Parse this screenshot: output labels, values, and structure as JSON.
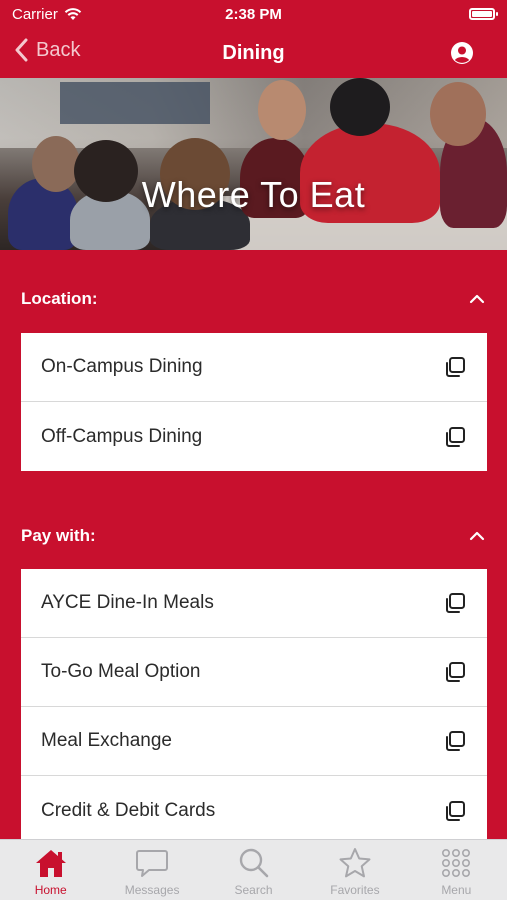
{
  "status_bar": {
    "carrier": "Carrier",
    "time": "2:38 PM"
  },
  "nav": {
    "back_label": "Back",
    "title": "Dining"
  },
  "hero": {
    "title": "Where To Eat"
  },
  "sections": [
    {
      "title": "Location:",
      "items": [
        "On-Campus Dining",
        "Off-Campus Dining"
      ]
    },
    {
      "title": "Pay with:",
      "items": [
        "AYCE Dine-In Meals",
        "To-Go Meal Option",
        "Meal Exchange",
        "Credit & Debit Cards"
      ]
    }
  ],
  "tabs": [
    {
      "label": "Home",
      "icon": "home-icon",
      "active": true
    },
    {
      "label": "Messages",
      "icon": "messages-icon",
      "active": false
    },
    {
      "label": "Search",
      "icon": "search-icon",
      "active": false
    },
    {
      "label": "Favorites",
      "icon": "star-icon",
      "active": false
    },
    {
      "label": "Menu",
      "icon": "grid-icon",
      "active": false
    }
  ],
  "colors": {
    "brand": "#c8102e",
    "tab_active": "#c8102e",
    "tab_inactive": "#a7a7ab"
  }
}
